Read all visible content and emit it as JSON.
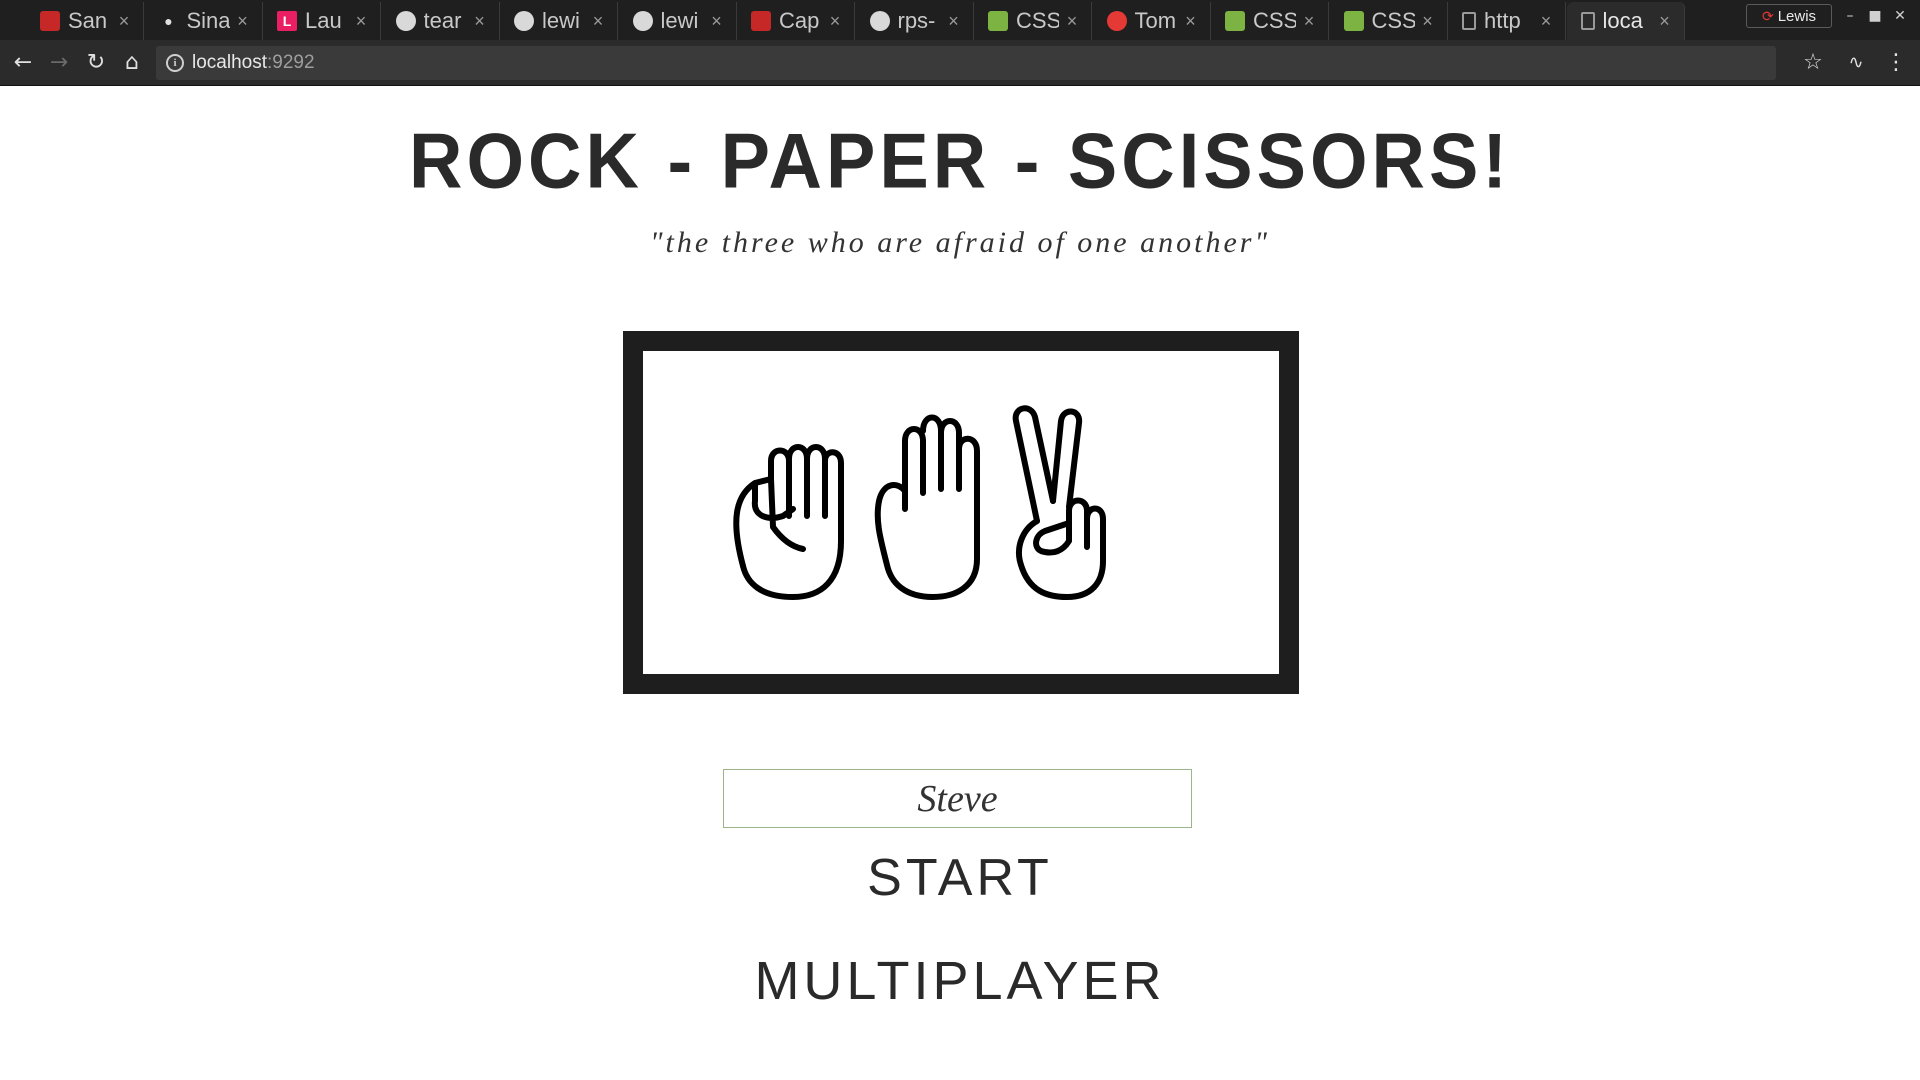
{
  "browser": {
    "tabs": [
      {
        "label": "San",
        "icon": "red-brand-icon",
        "active": false
      },
      {
        "label": "Sina",
        "icon": "fedora-hat-icon",
        "active": false
      },
      {
        "label": "Lau",
        "icon": "pink-l-icon",
        "active": false
      },
      {
        "label": "tear",
        "icon": "github-icon",
        "active": false
      },
      {
        "label": "lewi",
        "icon": "github-icon",
        "active": false
      },
      {
        "label": "lewi",
        "icon": "github-icon",
        "active": false
      },
      {
        "label": "Cap",
        "icon": "red-brand-icon",
        "active": false
      },
      {
        "label": "rps-",
        "icon": "github-icon",
        "active": false
      },
      {
        "label": "CSS",
        "icon": "green-css-icon",
        "active": false
      },
      {
        "label": "Tom",
        "icon": "tomato-icon",
        "active": false
      },
      {
        "label": "CSS",
        "icon": "green-css-icon",
        "active": false
      },
      {
        "label": "CSS",
        "icon": "green-css-icon",
        "active": false
      },
      {
        "label": "http",
        "icon": "page-icon",
        "active": false
      },
      {
        "label": "loca",
        "icon": "page-icon",
        "active": true
      }
    ],
    "tab_close_glyph": "×",
    "profile_name": "Lewis",
    "address": {
      "host": "localhost",
      "port": ":9292"
    }
  },
  "page": {
    "title": "ROCK - PAPER - SCISSORS!",
    "subtitle": "\"the three who are afraid of one another\"",
    "illustration_icons": [
      "rock-fist-icon",
      "paper-hand-icon",
      "scissors-hand-icon"
    ],
    "name_input_value": "Steve",
    "start_label": "START",
    "multiplayer_label": "MULTIPLAYER"
  },
  "colors": {
    "chrome_bg": "#2b2b2b",
    "tabstrip_bg": "#1f1f1f",
    "frame_border": "#1e1e1e",
    "text": "#2a2a2a",
    "input_border": "#9bb48a"
  }
}
